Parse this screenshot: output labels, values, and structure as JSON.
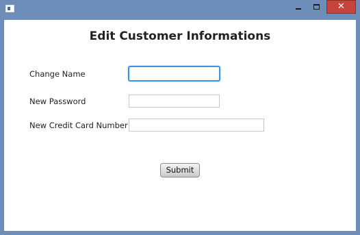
{
  "window": {
    "title": "",
    "close_symbol": "✕"
  },
  "form": {
    "title": "Edit Customer Informations",
    "fields": [
      {
        "label": "Change Name",
        "value": "",
        "placeholder": "",
        "focused": true
      },
      {
        "label": "New Password",
        "value": "",
        "placeholder": ""
      },
      {
        "label": "New Credit Card Number",
        "value": "",
        "placeholder": ""
      }
    ],
    "submit_label": "Submit"
  },
  "colors": {
    "titlebar": "#6e8db8",
    "close_button": "#c7443a",
    "focus_border": "#3c93e6"
  }
}
